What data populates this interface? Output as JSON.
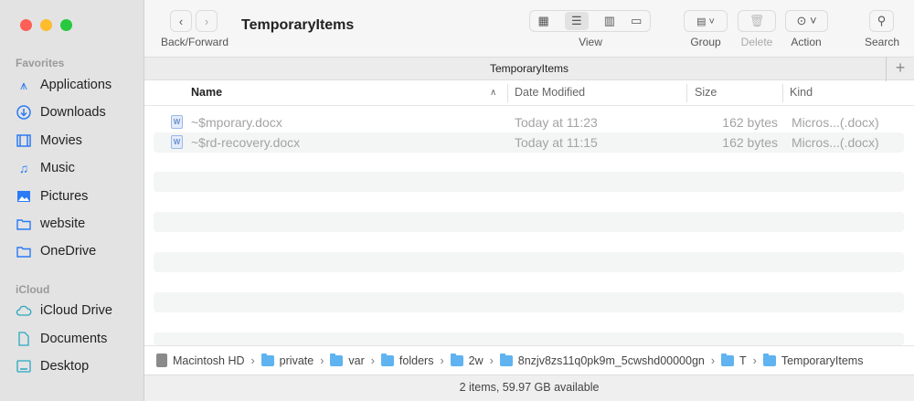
{
  "window": {
    "title": "TemporaryItems",
    "tab": "TemporaryItems",
    "status": "2 items, 59.97 GB available"
  },
  "toolbar": {
    "nav_label": "Back/Forward",
    "view_label": "View",
    "group_label": "Group",
    "delete_label": "Delete",
    "action_label": "Action",
    "search_label": "Search"
  },
  "sidebar": {
    "favorites_header": "Favorites",
    "favorites": [
      {
        "label": "Applications",
        "icon": "applications-icon"
      },
      {
        "label": "Downloads",
        "icon": "downloads-icon"
      },
      {
        "label": "Movies",
        "icon": "movies-icon"
      },
      {
        "label": "Music",
        "icon": "music-icon"
      },
      {
        "label": "Pictures",
        "icon": "pictures-icon"
      },
      {
        "label": "website",
        "icon": "folder-icon"
      },
      {
        "label": "OneDrive",
        "icon": "folder-icon"
      }
    ],
    "icloud_header": "iCloud",
    "icloud": [
      {
        "label": "iCloud Drive",
        "icon": "cloud-icon"
      },
      {
        "label": "Documents",
        "icon": "document-icon"
      },
      {
        "label": "Desktop",
        "icon": "desktop-icon"
      }
    ]
  },
  "columns": {
    "name": "Name",
    "date": "Date Modified",
    "size": "Size",
    "kind": "Kind"
  },
  "files": [
    {
      "name": "~$mporary.docx",
      "date": "Today at 11:23",
      "size": "162 bytes",
      "kind": "Micros...(.docx)"
    },
    {
      "name": "~$rd-recovery.docx",
      "date": "Today at 11:15",
      "size": "162 bytes",
      "kind": "Micros...(.docx)"
    }
  ],
  "path": [
    "Macintosh HD",
    "private",
    "var",
    "folders",
    "2w",
    "8nzjv8zs11q0pk9m_5cwshd00000gn",
    "T",
    "TemporaryItems"
  ],
  "colors": {
    "accent": "#2a7bf5",
    "icloud": "#2aa7c0"
  }
}
